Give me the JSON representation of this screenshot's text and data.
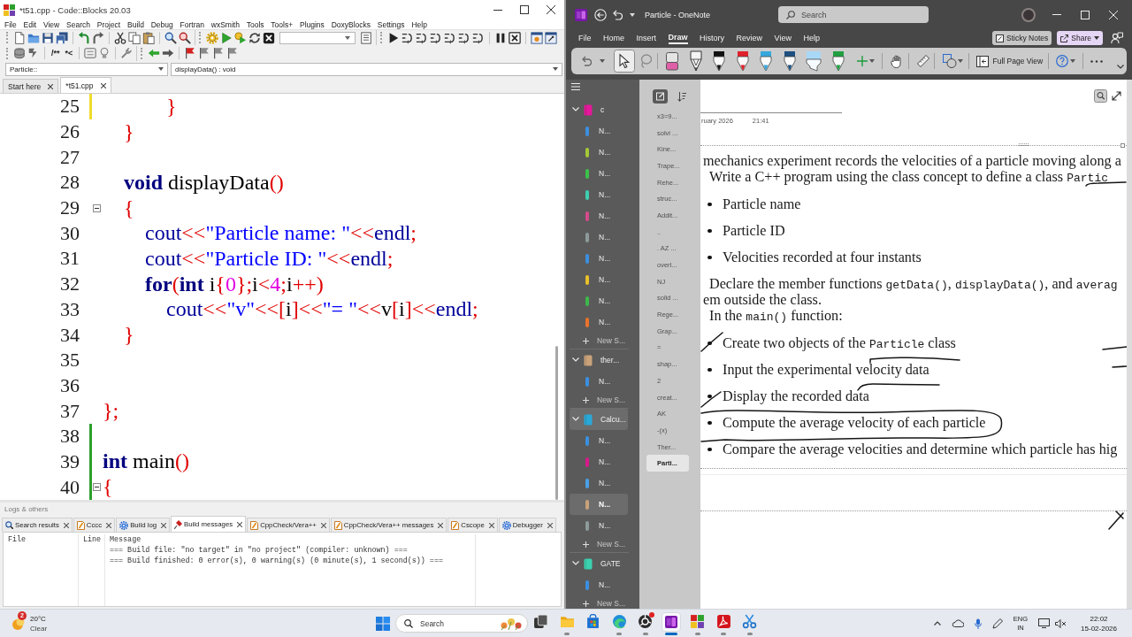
{
  "codeblocks": {
    "title": "*t51.cpp - Code::Blocks 20.03",
    "menu": [
      "File",
      "Edit",
      "View",
      "Search",
      "Project",
      "Build",
      "Debug",
      "Fortran",
      "wxSmith",
      "Tools",
      "Tools+",
      "Plugins",
      "DoxyBlocks",
      "Settings",
      "Help"
    ],
    "doxy_buttons": [
      "/**",
      "*<"
    ],
    "scope": "Particle::",
    "symbol": "displayData() : void",
    "tabs": [
      {
        "label": "Start here",
        "selected": false
      },
      {
        "label": "*t51.cpp",
        "selected": true
      }
    ],
    "lines": [
      {
        "number": "25",
        "changed": true,
        "color": "#f0dc2a",
        "fold": false,
        "tokens": [
          {
            "kind": "operator",
            "text": "            }"
          }
        ]
      },
      {
        "number": "26",
        "changed": false,
        "fold": false,
        "tokens": [
          {
            "kind": "operator",
            "text": "    }"
          }
        ]
      },
      {
        "number": "27",
        "changed": false,
        "fold": false
      },
      {
        "number": "28",
        "changed": false,
        "fold": false,
        "tokens": [
          {
            "kind": "keyword",
            "text": "    void"
          },
          {
            "kind": "plain",
            "text": " displayData"
          },
          {
            "kind": "operator",
            "text": "()"
          }
        ]
      },
      {
        "number": "29",
        "changed": false,
        "fold": true,
        "tokens": [
          {
            "kind": "operator",
            "text": "    {"
          }
        ]
      },
      {
        "number": "30",
        "changed": false,
        "fold": false,
        "tokens": [
          {
            "kind": "name",
            "text": "        cout"
          },
          {
            "kind": "operator",
            "text": "<<"
          },
          {
            "kind": "string",
            "text": "\"Particle name: \""
          },
          {
            "kind": "operator",
            "text": "<<"
          },
          {
            "kind": "name",
            "text": "endl"
          },
          {
            "kind": "operator",
            "text": ";"
          }
        ]
      },
      {
        "number": "31",
        "changed": false,
        "fold": false,
        "tokens": [
          {
            "kind": "name",
            "text": "        cout"
          },
          {
            "kind": "operator",
            "text": "<<"
          },
          {
            "kind": "string",
            "text": "\"Particle ID: \""
          },
          {
            "kind": "operator",
            "text": "<<"
          },
          {
            "kind": "name",
            "text": "endl"
          },
          {
            "kind": "operator",
            "text": ";"
          }
        ]
      },
      {
        "number": "32",
        "changed": false,
        "fold": false,
        "tokens": [
          {
            "kind": "keyword",
            "text": "        for"
          },
          {
            "kind": "operator",
            "text": "("
          },
          {
            "kind": "keyword",
            "text": "int"
          },
          {
            "kind": "plain",
            "text": " i"
          },
          {
            "kind": "operator",
            "text": "{"
          },
          {
            "kind": "number",
            "text": "0"
          },
          {
            "kind": "operator",
            "text": "};"
          },
          {
            "kind": "plain",
            "text": "i"
          },
          {
            "kind": "operator",
            "text": "<"
          },
          {
            "kind": "number",
            "text": "4"
          },
          {
            "kind": "operator",
            "text": ";"
          },
          {
            "kind": "plain",
            "text": "i"
          },
          {
            "kind": "operator",
            "text": "++)"
          }
        ]
      },
      {
        "number": "33",
        "changed": false,
        "fold": false,
        "tokens": [
          {
            "kind": "name",
            "text": "            cout"
          },
          {
            "kind": "operator",
            "text": "<<"
          },
          {
            "kind": "string",
            "text": "\"v\""
          },
          {
            "kind": "operator",
            "text": "<<["
          },
          {
            "kind": "plain",
            "text": "i"
          },
          {
            "kind": "operator",
            "text": "]<<"
          },
          {
            "kind": "string",
            "text": "\"= \""
          },
          {
            "kind": "operator",
            "text": "<<"
          },
          {
            "kind": "plain",
            "text": "v"
          },
          {
            "kind": "operator",
            "text": "["
          },
          {
            "kind": "plain",
            "text": "i"
          },
          {
            "kind": "operator",
            "text": "]<<"
          },
          {
            "kind": "name",
            "text": "endl"
          },
          {
            "kind": "operator",
            "text": ";"
          }
        ]
      },
      {
        "number": "34",
        "changed": false,
        "fold": false,
        "tokens": [
          {
            "kind": "operator",
            "text": "    }"
          }
        ]
      },
      {
        "number": "35",
        "changed": false,
        "fold": false
      },
      {
        "number": "36",
        "changed": false,
        "fold": false
      },
      {
        "number": "37",
        "changed": false,
        "fold": false,
        "tokens": [
          {
            "kind": "operator",
            "text": "};"
          }
        ]
      },
      {
        "number": "38",
        "changed": true,
        "color": "#2ca02c",
        "fold": false
      },
      {
        "number": "39",
        "changed": true,
        "color": "#2ca02c",
        "fold": false,
        "tokens": [
          {
            "kind": "keyword",
            "text": "int"
          },
          {
            "kind": "plain",
            "text": " main"
          },
          {
            "kind": "operator",
            "text": "()"
          }
        ]
      },
      {
        "number": "40",
        "changed": true,
        "color": "#2ca02c",
        "fold": true,
        "tokens": [
          {
            "kind": "operator",
            "text": "{"
          }
        ]
      }
    ],
    "logs": {
      "title": "Logs & others",
      "tabs": [
        {
          "label": "Search results",
          "kind": "search",
          "selected": false
        },
        {
          "label": "Cccc",
          "kind": "tool",
          "selected": false
        },
        {
          "label": "Build log",
          "kind": "gear",
          "selected": false
        },
        {
          "label": "Build messages",
          "kind": "pin",
          "selected": true
        },
        {
          "label": "CppCheck/Vera++",
          "kind": "tool",
          "selected": false
        },
        {
          "label": "CppCheck/Vera++ messages",
          "kind": "tool",
          "selected": false
        },
        {
          "label": "Cscope",
          "kind": "tool",
          "selected": false
        },
        {
          "label": "Debugger",
          "kind": "gear",
          "selected": false
        }
      ],
      "columns": [
        "File",
        "Line",
        "Message"
      ],
      "messages": [
        "=== Build file: \"no target\" in \"no project\" (compiler: unknown) ===",
        "=== Build finished: 0 error(s), 0 warning(s) (0 minute(s), 1 second(s)) ==="
      ]
    }
  },
  "onenote": {
    "title": "Particle - OneNote",
    "search_placeholder": "Search",
    "ribbon_tabs": [
      {
        "label": "File",
        "selected": false
      },
      {
        "label": "Home",
        "selected": false
      },
      {
        "label": "Insert",
        "selected": false
      },
      {
        "label": "Draw",
        "selected": true
      },
      {
        "label": "History",
        "selected": false
      },
      {
        "label": "Review",
        "selected": false
      },
      {
        "label": "View",
        "selected": false
      },
      {
        "label": "Help",
        "selected": false
      }
    ],
    "sticky_notes": "Sticky Notes",
    "share": "Share",
    "tools": [
      {
        "kind": "pointer",
        "selected": true
      },
      {
        "kind": "lasso",
        "selected": false
      },
      {
        "kind": "eraser",
        "selected": false
      },
      {
        "kind": "pencil",
        "color": "#f4f4f4",
        "selected": false
      },
      {
        "kind": "pen",
        "color": "#111111",
        "selected": false
      },
      {
        "kind": "pen",
        "color": "#e0202a",
        "selected": false
      },
      {
        "kind": "pen",
        "color": "#35a7dc",
        "selected": false
      },
      {
        "kind": "pen",
        "color": "#1d4f80",
        "selected": false
      },
      {
        "kind": "highlighter",
        "color": "#a8d8f6",
        "selected": false
      },
      {
        "kind": "pen",
        "color": "#20a040",
        "selected": false
      }
    ],
    "full_page_view": "Full Page View",
    "notebooks": [
      {
        "name": "c",
        "color": "#e3189a",
        "expanded": true,
        "selected": false,
        "new_section": "New S...",
        "sections": [
          {
            "name": "N...",
            "color": "#3b8fe0",
            "selected": false
          },
          {
            "name": "N...",
            "color": "#a5c838",
            "selected": false
          },
          {
            "name": "N...",
            "color": "#3cc24a",
            "selected": false
          },
          {
            "name": "N...",
            "color": "#3ccfb0",
            "selected": false
          },
          {
            "name": "N...",
            "color": "#d64a8a",
            "selected": false
          },
          {
            "name": "N...",
            "color": "#8e9a9a",
            "selected": false
          },
          {
            "name": "N...",
            "color": "#3b8fe0",
            "selected": false
          },
          {
            "name": "N...",
            "color": "#e8c02a",
            "selected": false
          },
          {
            "name": "N...",
            "color": "#3cb84a",
            "selected": false
          },
          {
            "name": "N...",
            "color": "#e8732a",
            "selected": false
          }
        ]
      },
      {
        "name": "ther...",
        "color": "#c9a27a",
        "expanded": true,
        "selected": false,
        "new_section": "New S...",
        "sections": [
          {
            "name": "N...",
            "color": "#3b8fe0",
            "selected": false
          }
        ]
      },
      {
        "name": "Calcu...",
        "color": "#2aa8d8",
        "expanded": true,
        "selected": true,
        "new_section": "New S...",
        "sections": [
          {
            "name": "N...",
            "color": "#3b8fe0",
            "selected": false
          },
          {
            "name": "N...",
            "color": "#d61a8a",
            "selected": false
          },
          {
            "name": "N...",
            "color": "#4aa0e8",
            "selected": false
          },
          {
            "name": "N...",
            "color": "#c9a27a",
            "selected": true
          },
          {
            "name": "N...",
            "color": "#8e9a9a",
            "selected": false
          }
        ]
      },
      {
        "name": "GATE",
        "color": "#3cd0b0",
        "expanded": true,
        "selected": false,
        "new_section": "New S...",
        "sections": [
          {
            "name": "N...",
            "color": "#3b8fe0",
            "selected": false
          }
        ]
      }
    ],
    "pages": [
      {
        "title": "x3=9...",
        "selected": false
      },
      {
        "title": "solvi ...",
        "selected": false
      },
      {
        "title": "Kine...",
        "selected": false
      },
      {
        "title": "Trape...",
        "selected": false
      },
      {
        "title": "Rehe...",
        "selected": false
      },
      {
        "title": "struc...",
        "selected": false
      },
      {
        "title": "Addit...",
        "selected": false
      },
      {
        "title": "..",
        "selected": false
      },
      {
        "title": ". AZ ...",
        "selected": false
      },
      {
        "title": "overl...",
        "selected": false
      },
      {
        "title": "NJ",
        "selected": false
      },
      {
        "title": "solid ...",
        "selected": false
      },
      {
        "title": "Rege...",
        "selected": false
      },
      {
        "title": "Grap...",
        "selected": false
      },
      {
        "title": "=",
        "selected": false
      },
      {
        "title": "shap...",
        "selected": false
      },
      {
        "title": "2",
        "selected": false
      },
      {
        "title": "creat...",
        "selected": false
      },
      {
        "title": "AK",
        "selected": false
      },
      {
        "title": "-(x)",
        "selected": false
      },
      {
        "title": "Ther...",
        "selected": false
      },
      {
        "title": "Parti...",
        "selected": true
      }
    ],
    "page": {
      "date": "ruary 2026",
      "time": "21:41",
      "blocks": [
        {
          "kind": "line",
          "segments": [
            {
              "kind": "text",
              "text": "mechanics experiment records the velocities of a particle moving along a"
            }
          ]
        },
        {
          "kind": "para",
          "segments": [
            {
              "kind": "text",
              "text": "Write a C++ program using the class concept to define a class "
            },
            {
              "kind": "code",
              "text": "Partic"
            }
          ]
        },
        {
          "kind": "bullet",
          "segments": [
            {
              "kind": "text",
              "text": "Particle name"
            }
          ]
        },
        {
          "kind": "bullet",
          "segments": [
            {
              "kind": "text",
              "text": "Particle ID"
            }
          ]
        },
        {
          "kind": "bullet",
          "segments": [
            {
              "kind": "text",
              "text": "Velocities recorded at four instants"
            }
          ]
        },
        {
          "kind": "para",
          "segments": [
            {
              "kind": "text",
              "text": "Declare the member functions "
            },
            {
              "kind": "code",
              "text": "getData()"
            },
            {
              "kind": "text",
              "text": ", "
            },
            {
              "kind": "code",
              "text": "displayData()"
            },
            {
              "kind": "text",
              "text": ", and "
            },
            {
              "kind": "code",
              "text": "averag"
            }
          ]
        },
        {
          "kind": "line",
          "segments": [
            {
              "kind": "text",
              "text": "em outside the class."
            }
          ]
        },
        {
          "kind": "para",
          "segments": [
            {
              "kind": "text",
              "text": "In the "
            },
            {
              "kind": "code",
              "text": "main()"
            },
            {
              "kind": "text",
              "text": " function:"
            }
          ]
        },
        {
          "kind": "bullet",
          "segments": [
            {
              "kind": "text",
              "text": "Create two objects of the "
            },
            {
              "kind": "code",
              "text": "Particle"
            },
            {
              "kind": "text",
              "text": " class"
            }
          ]
        },
        {
          "kind": "bullet",
          "segments": [
            {
              "kind": "text",
              "text": "Input the experimental velocity data"
            }
          ]
        },
        {
          "kind": "bullet",
          "segments": [
            {
              "kind": "text",
              "text": "Display the recorded data"
            }
          ]
        },
        {
          "kind": "bullet",
          "segments": [
            {
              "kind": "text",
              "text": "Compute the average velocity of each particle"
            }
          ]
        },
        {
          "kind": "bullet",
          "segments": [
            {
              "kind": "text",
              "text": "Compare the average velocities and determine which particle has hig"
            }
          ]
        }
      ]
    }
  },
  "taskbar": {
    "weather": {
      "badge": "2",
      "temperature": "20°C",
      "condition": "Clear"
    },
    "search_placeholder": "Search",
    "apps": [
      {
        "kind": "task-view",
        "running": false,
        "active": false,
        "notification": false
      },
      {
        "kind": "files",
        "running": true,
        "active": false,
        "notification": false
      },
      {
        "kind": "store",
        "running": false,
        "active": false,
        "notification": false
      },
      {
        "kind": "browser",
        "running": true,
        "active": false,
        "notification": false
      },
      {
        "kind": "recorder",
        "running": true,
        "active": false,
        "notification": true
      },
      {
        "kind": "notes",
        "running": true,
        "active": true,
        "notification": false
      },
      {
        "kind": "ide",
        "running": true,
        "active": false,
        "notification": false
      },
      {
        "kind": "pdf",
        "running": true,
        "active": false,
        "notification": false
      },
      {
        "kind": "snipping",
        "running": true,
        "active": false,
        "notification": false
      }
    ],
    "language": "ENG",
    "region": "IN",
    "time": "22:02",
    "date": "15-02-2026"
  }
}
